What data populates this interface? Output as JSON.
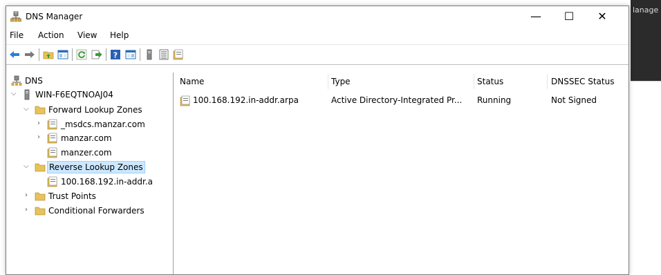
{
  "window": {
    "title": "DNS Manager",
    "minimize_glyph": "—",
    "maximize_glyph": "☐",
    "close_glyph": "✕"
  },
  "background_app": {
    "title_fragment": "lanage"
  },
  "menu": {
    "items": [
      "File",
      "Action",
      "View",
      "Help"
    ]
  },
  "toolbar": {
    "icons": [
      "back-icon",
      "forward-icon",
      "up-folder-icon",
      "show-tree-icon",
      "refresh-icon",
      "export-icon",
      "help-icon",
      "console-tree-icon",
      "server-icon",
      "list-icon",
      "zone-icon"
    ]
  },
  "tree": {
    "root": "DNS",
    "server": "WIN-F6EQTNOAJ04",
    "forward_zones": "Forward Lookup Zones",
    "forward_children": [
      "_msdcs.manzar.com",
      "manzar.com",
      "manzer.com"
    ],
    "reverse_zones": "Reverse Lookup Zones",
    "reverse_children": [
      "100.168.192.in-addr.a"
    ],
    "trust_points": "Trust Points",
    "conditional_forwarders": "Conditional Forwarders"
  },
  "list": {
    "columns": [
      "Name",
      "Type",
      "Status",
      "DNSSEC Status"
    ],
    "rows": [
      {
        "name": "100.168.192.in-addr.arpa",
        "type": "Active Directory-Integrated Pr...",
        "status": "Running",
        "dnssec": "Not Signed"
      }
    ]
  },
  "colors": {
    "selection_bg": "#cce8ff",
    "selection_border": "#99d1ff",
    "folder_yellow": "#e8c25a",
    "arrow_blue": "#2a7fd4"
  }
}
